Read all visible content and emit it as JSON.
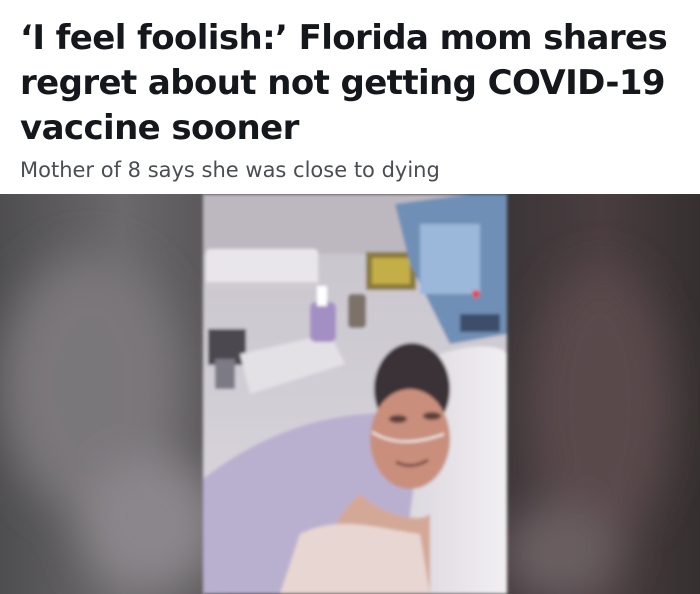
{
  "article": {
    "headline": "‘I feel foolish:’ Florida mom shares regret about not getting COVID-19 vaccine sooner",
    "subheadline": "Mother of 8 says she was close to dying"
  },
  "media": {
    "type": "video-still",
    "accent_colors": {
      "wall": "#d3cfd6",
      "bed_sheet": "#e8e4ea",
      "background_blur_left": "#585758",
      "background_blur_right": "#3f3437"
    }
  }
}
